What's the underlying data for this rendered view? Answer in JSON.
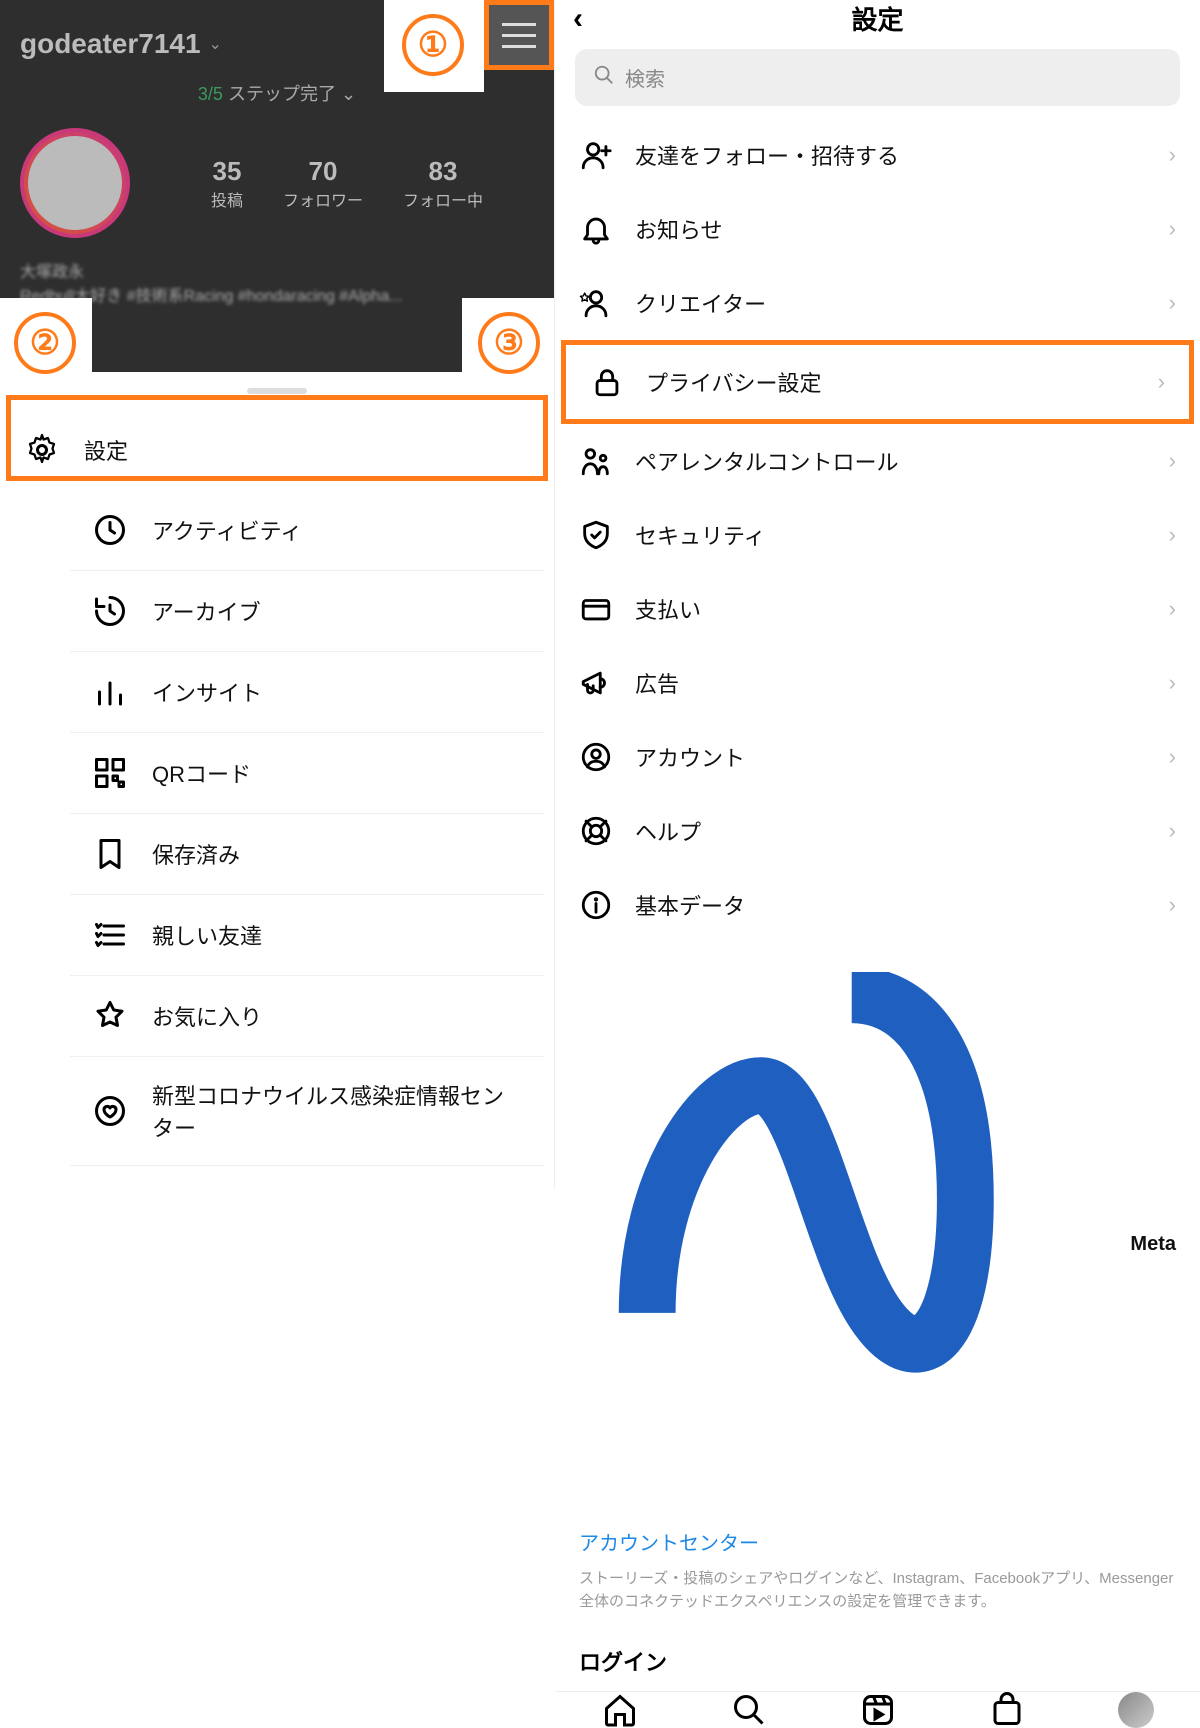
{
  "colors": {
    "accent": "#ff7b1a",
    "link": "#1e88e5"
  },
  "markers": {
    "one": "①",
    "two": "②",
    "three": "③"
  },
  "left": {
    "username": "godeater7141",
    "steps_count": "3/5",
    "steps_suffix": " ステップ完了",
    "stats": [
      {
        "num": "35",
        "label": "投稿"
      },
      {
        "num": "70",
        "label": "フォロワー"
      },
      {
        "num": "83",
        "label": "フォロー中"
      }
    ],
    "bio_name": "大塚政永",
    "bio_text": "Redbull大好き #技術系Racing #hondaracing #Alpha...",
    "menu": [
      {
        "icon": "gear",
        "label": "設定"
      },
      {
        "icon": "clock",
        "label": "アクティビティ"
      },
      {
        "icon": "archive",
        "label": "アーカイブ"
      },
      {
        "icon": "chart",
        "label": "インサイト"
      },
      {
        "icon": "qr",
        "label": "QRコード"
      },
      {
        "icon": "bookmark",
        "label": "保存済み"
      },
      {
        "icon": "star-list",
        "label": "親しい友達"
      },
      {
        "icon": "star",
        "label": "お気に入り"
      },
      {
        "icon": "heart-shield",
        "label": "新型コロナウイルス感染症情報センター"
      }
    ]
  },
  "right": {
    "title": "設定",
    "search_placeholder": "検索",
    "items": [
      {
        "icon": "person-plus",
        "label": "友達をフォロー・招待する"
      },
      {
        "icon": "bell",
        "label": "お知らせ"
      },
      {
        "icon": "star-person",
        "label": "クリエイター"
      },
      {
        "icon": "lock",
        "label": "プライバシー設定",
        "highlight": true
      },
      {
        "icon": "parent",
        "label": "ペアレンタルコントロール"
      },
      {
        "icon": "shield",
        "label": "セキュリティ"
      },
      {
        "icon": "card",
        "label": "支払い"
      },
      {
        "icon": "megaphone",
        "label": "広告"
      },
      {
        "icon": "account",
        "label": "アカウント"
      },
      {
        "icon": "help",
        "label": "ヘルプ"
      },
      {
        "icon": "info",
        "label": "基本データ"
      }
    ],
    "meta_brand": "Meta",
    "meta_link": "アカウントセンター",
    "meta_desc": "ストーリーズ・投稿のシェアやログインなど、Instagram、Facebookアプリ、Messenger全体のコネクテッドエクスペリエンスの設定を管理できます。",
    "login_heading": "ログイン"
  }
}
